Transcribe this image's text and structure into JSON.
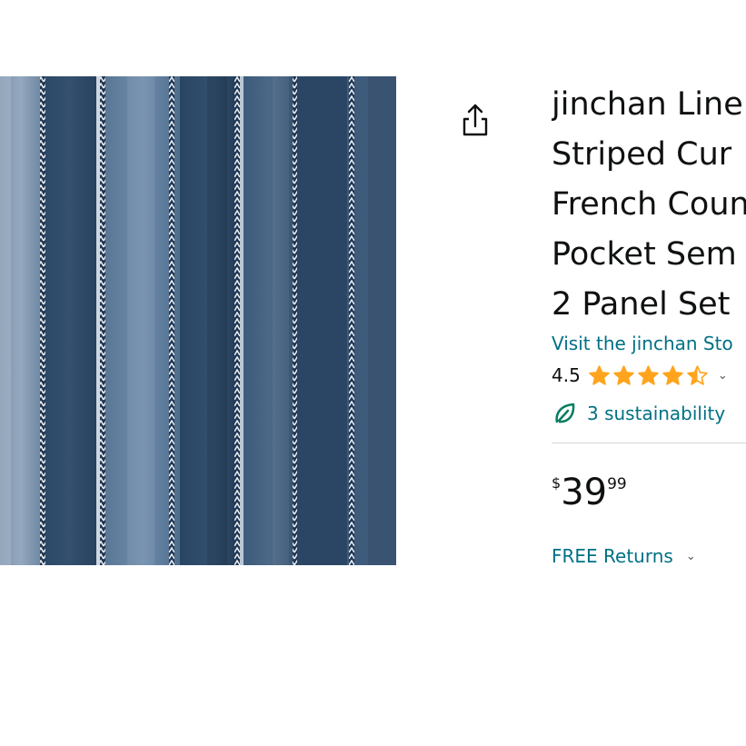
{
  "product": {
    "title_lines": [
      "jinchan Line",
      "Striped Cur",
      "French Coun",
      "Pocket Sem",
      "2 Panel Set"
    ],
    "store_link": "Visit the jinchan Sto",
    "rating_value": "4.5",
    "rating_stars": 4.5,
    "sustainability": "3 sustainability",
    "price": {
      "symbol": "$",
      "whole": "39",
      "fraction": "99"
    },
    "returns": "FREE Returns"
  },
  "icons": {
    "share": "share-icon",
    "rating_dropdown": "chevron-down-icon",
    "sustainability": "leaf-icon",
    "returns_dropdown": "chevron-down-icon"
  },
  "colors": {
    "link": "#007185",
    "star": "#ffa41c",
    "text": "#0f1111",
    "divider": "#d5d9d9",
    "leaf": "#067d62"
  }
}
